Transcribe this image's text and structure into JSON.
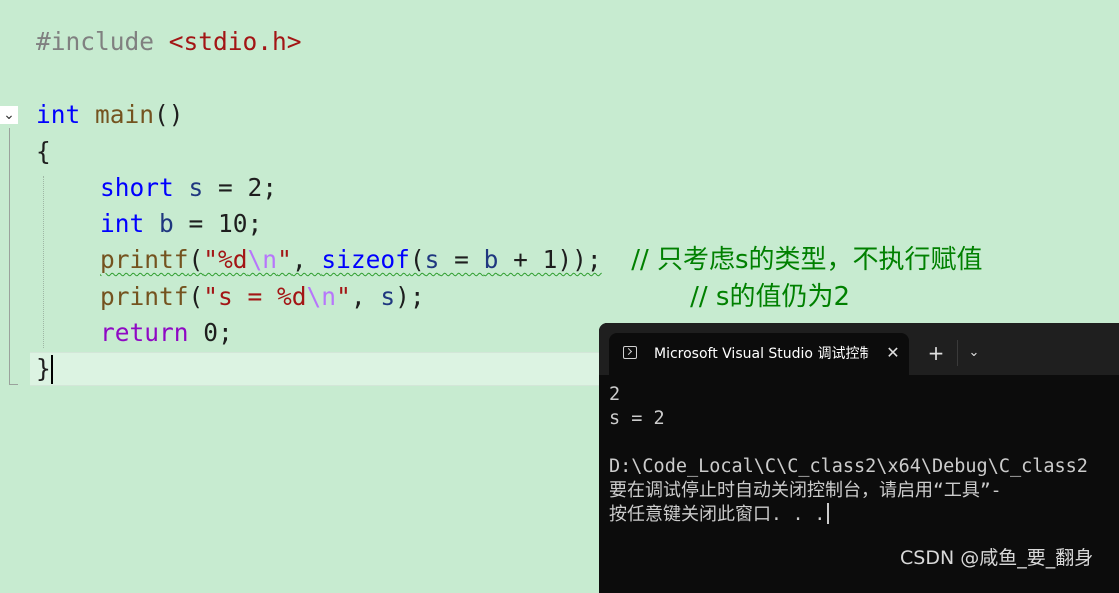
{
  "editor": {
    "line1": {
      "directive": "#include",
      "header": "<stdio.h>"
    },
    "line3": {
      "type": "int",
      "name": "main",
      "parens": "()"
    },
    "line4": {
      "brace": "{"
    },
    "line5": {
      "type": "short",
      "rest1": " ",
      "var": "s",
      "rest2": " = 2;"
    },
    "line6": {
      "type": "int",
      "rest1": " ",
      "var": "b",
      "rest2": " = 10;"
    },
    "line7": {
      "fn": "printf",
      "open": "(",
      "q1": "\"%d",
      "esc": "\\n",
      "q2": "\"",
      "sep": ", ",
      "sizeof": "sizeof",
      "p1": "(",
      "v1": "s",
      "eq": " = ",
      "v2": "b",
      "tail": " + 1));",
      "pad": "  ",
      "comment": "// 只考虑s的类型，不执行赋值"
    },
    "line8": {
      "fn": "printf",
      "open": "(",
      "q1": "\"s = %d",
      "esc": "\\n",
      "q2": "\"",
      "sep": ", ",
      "var": "s",
      "tail": ");",
      "pad": "                  ",
      "comment": "// s的值仍为2"
    },
    "line9": {
      "kw": "return",
      "rest": " 0;"
    },
    "line10": {
      "brace": "}"
    }
  },
  "console": {
    "tab_title": "Microsoft Visual Studio 调试控制台",
    "close_glyph": "✕",
    "new_tab_glyph": "+",
    "dropdown_glyph": "⌄",
    "lines": [
      "2",
      "s = 2",
      "",
      "D:\\Code_Local\\C\\C_class2\\x64\\Debug\\C_class2",
      "要在调试停止时自动关闭控制台，请启用“工具”-",
      "按任意键关闭此窗口. . ."
    ]
  },
  "watermark": "CSDN @咸鱼_要_翻身",
  "colors": {
    "background": "#c7ebd0",
    "keyword": "#0000ff",
    "function": "#74531f",
    "string": "#a31515",
    "comment": "#008000",
    "console_bg": "#0c0c0c"
  }
}
